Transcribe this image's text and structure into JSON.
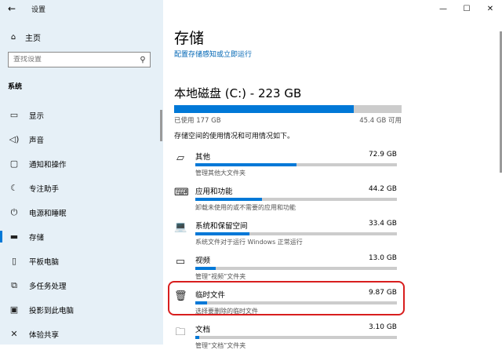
{
  "window": {
    "title": "设置",
    "controls": [
      "—",
      "☐",
      "✕"
    ]
  },
  "sidebar": {
    "home_label": "主页",
    "search_placeholder": "查找设置",
    "section_title": "系统",
    "items": [
      {
        "label": "显示",
        "icon": "display-icon"
      },
      {
        "label": "声音",
        "icon": "speaker-icon"
      },
      {
        "label": "通知和操作",
        "icon": "notification-icon"
      },
      {
        "label": "专注助手",
        "icon": "moon-icon"
      },
      {
        "label": "电源和睡眠",
        "icon": "power-icon"
      },
      {
        "label": "存储",
        "icon": "storage-icon",
        "active": true
      },
      {
        "label": "平板电脑",
        "icon": "tablet-icon"
      },
      {
        "label": "多任务处理",
        "icon": "multitask-icon"
      },
      {
        "label": "投影到此电脑",
        "icon": "project-icon"
      },
      {
        "label": "体验共享",
        "icon": "share-icon"
      }
    ]
  },
  "main": {
    "title": "存储",
    "config_link": "配置存储感知或立即运行",
    "disk_title": "本地磁盘 (C:) - 223 GB",
    "disk_used_fraction": 0.79,
    "used_text": "已使用 177 GB",
    "available_text": "45.4 GB 可用",
    "description": "存储空间的使用情况和可用情况如下。",
    "categories": [
      {
        "name": "其他",
        "size": "72.9 GB",
        "sub": "管理其他大文件夹",
        "fraction": 0.5,
        "icon": "other-icon"
      },
      {
        "name": "应用和功能",
        "size": "44.2 GB",
        "sub": "卸载未使用的或不需要的应用和功能",
        "fraction": 0.33,
        "icon": "apps-icon"
      },
      {
        "name": "系统和保留空间",
        "size": "33.4 GB",
        "sub": "系统文件对于运行 Windows 正常运行",
        "fraction": 0.27,
        "icon": "system-icon"
      },
      {
        "name": "视频",
        "size": "13.0 GB",
        "sub": "管理“视频”文件夹",
        "fraction": 0.1,
        "icon": "video-icon"
      },
      {
        "name": "临时文件",
        "size": "9.87 GB",
        "sub": "选择要删除的临时文件",
        "fraction": 0.06,
        "icon": "trash-icon"
      },
      {
        "name": "文档",
        "size": "3.10 GB",
        "sub": "管理“文档”文件夹",
        "fraction": 0.02,
        "icon": "document-icon"
      }
    ]
  }
}
